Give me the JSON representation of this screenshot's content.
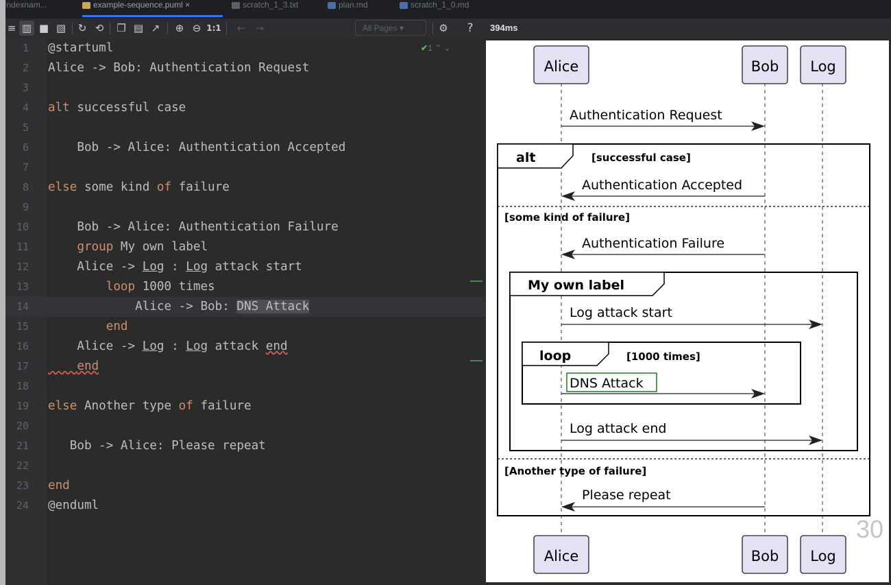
{
  "tabs": [
    {
      "label": "Indexnam..."
    },
    {
      "label": "example-sequence.puml ×"
    },
    {
      "label": "scratch_1_3.txt"
    },
    {
      "label": "plan.md"
    },
    {
      "label": "scratch_1_0.md"
    }
  ],
  "toolbar": {
    "page_selector": "All Pages",
    "zoom_reset": "1:1",
    "help": "?",
    "render_time": "394ms"
  },
  "editor": {
    "inspection": "1",
    "lines": [
      {
        "n": "1",
        "text": "@startuml"
      },
      {
        "n": "2",
        "text": "Alice -> Bob: Authentication Request"
      },
      {
        "n": "3",
        "text": ""
      },
      {
        "n": "4",
        "kw": "alt",
        "rest": " successful case"
      },
      {
        "n": "5",
        "text": ""
      },
      {
        "n": "6",
        "text": "    Bob -> Alice: Authentication Accepted"
      },
      {
        "n": "7",
        "text": ""
      },
      {
        "n": "8",
        "kw": "else",
        "mid": " some kind ",
        "kw2": "of",
        "rest": " failure"
      },
      {
        "n": "9",
        "text": ""
      },
      {
        "n": "10",
        "text": "    Bob -> Alice: Authentication Failure"
      },
      {
        "n": "11",
        "indent": "    ",
        "kw": "group",
        "rest": " My own label"
      },
      {
        "n": "12",
        "pre": "    Alice -> ",
        "u1": "Log",
        "mid": " : ",
        "u2": "Log",
        "rest": " attack start"
      },
      {
        "n": "13",
        "indent": "        ",
        "kw": "loop",
        "rest": " 1000 times"
      },
      {
        "n": "14",
        "pre": "            Alice -> Bob: ",
        "hl": "DNS Attack"
      },
      {
        "n": "15",
        "indent": "        ",
        "kw": "end"
      },
      {
        "n": "16",
        "pre": "    Alice -> ",
        "u1": "Log",
        "mid": " : ",
        "u2": "Log",
        "mid2": " attack ",
        "w": "end"
      },
      {
        "n": "17",
        "w_indent": "    ",
        "kw_w": "end"
      },
      {
        "n": "18",
        "text": ""
      },
      {
        "n": "19",
        "kw": "else",
        "mid": " Another type ",
        "kw2": "of",
        "rest": " failure"
      },
      {
        "n": "20",
        "text": ""
      },
      {
        "n": "21",
        "text": "   Bob -> Alice: Please repeat"
      },
      {
        "n": "22",
        "text": ""
      },
      {
        "n": "23",
        "kw": "end"
      },
      {
        "n": "24",
        "text": "@enduml"
      }
    ]
  },
  "diagram": {
    "participants": [
      "Alice",
      "Bob",
      "Log"
    ],
    "messages": [
      {
        "text": "Authentication Request"
      },
      {
        "text": "Authentication Accepted"
      },
      {
        "text": "Authentication Failure"
      },
      {
        "text": "Log attack start"
      },
      {
        "text": "DNS Attack"
      },
      {
        "text": "Log attack end"
      },
      {
        "text": "Please repeat"
      }
    ],
    "fragments": [
      {
        "keyword": "alt",
        "condition": "[successful case]"
      },
      {
        "keyword": "My own label",
        "condition": ""
      },
      {
        "keyword": "loop",
        "condition": "[1000 times]"
      }
    ],
    "else_labels": [
      "[some kind of failure]",
      "[Another type of failure]"
    ],
    "page_number": "30"
  }
}
